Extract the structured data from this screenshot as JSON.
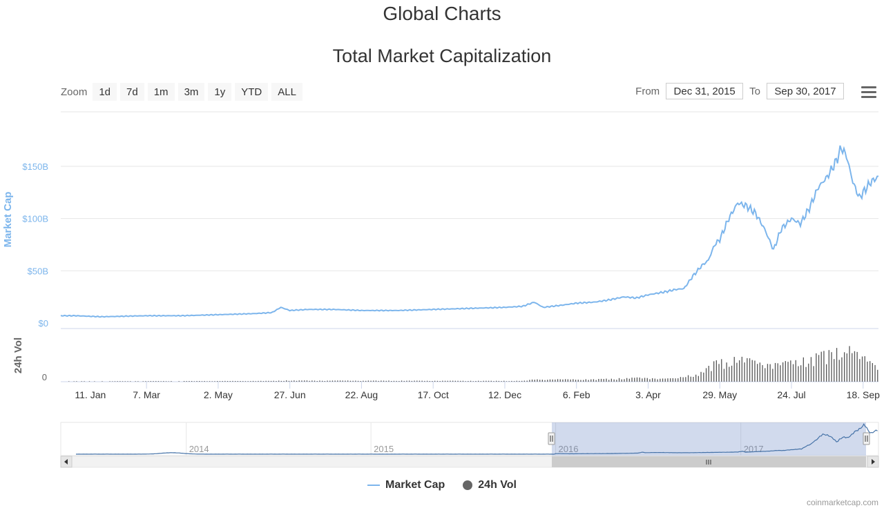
{
  "page": {
    "title": "Global Charts"
  },
  "toolbar": {
    "zoom_label": "Zoom",
    "zoom_buttons": [
      "1d",
      "7d",
      "1m",
      "3m",
      "1y",
      "YTD",
      "ALL"
    ],
    "from_label": "From",
    "from_value": "Dec 31, 2015",
    "to_label": "To",
    "to_value": "Sep 30, 2017",
    "menu_icon": "hamburger-menu-icon"
  },
  "legend": [
    {
      "label": "Market Cap",
      "color": "#7cb5ec",
      "icon": "line-icon"
    },
    {
      "label": "24h Vol",
      "color": "#666666",
      "icon": "circle-icon"
    }
  ],
  "credit": "coinmarketcap.com",
  "colors": {
    "market_cap": "#7cb5ec",
    "volume": "#555555",
    "navigator_line": "#4572a7",
    "navigator_mask": "rgba(102,133,194,0.3)"
  },
  "chart_data": {
    "type": "line",
    "title": "Total Market Capitalization",
    "x_tick_labels": [
      "11. Jan",
      "7. Mar",
      "2. May",
      "27. Jun",
      "22. Aug",
      "17. Oct",
      "12. Dec",
      "6. Feb",
      "3. Apr",
      "29. May",
      "24. Jul",
      "18. Sep"
    ],
    "market_cap": {
      "ylabel": "Market Cap",
      "y_tick_labels": [
        "$0",
        "$50B",
        "$100B",
        "$150B"
      ],
      "ylim": [
        0,
        200
      ],
      "unit": "billion USD",
      "series": [
        {
          "name": "Market Cap",
          "x": [
            "2015-12-31",
            "2016-01-11",
            "2016-02-01",
            "2016-03-07",
            "2016-04-04",
            "2016-05-02",
            "2016-05-30",
            "2016-06-13",
            "2016-06-20",
            "2016-06-27",
            "2016-07-11",
            "2016-08-01",
            "2016-08-22",
            "2016-09-19",
            "2016-10-17",
            "2016-11-14",
            "2016-12-12",
            "2016-12-26",
            "2017-01-04",
            "2017-01-11",
            "2017-01-25",
            "2017-02-06",
            "2017-02-20",
            "2017-03-03",
            "2017-03-15",
            "2017-03-25",
            "2017-04-03",
            "2017-04-17",
            "2017-04-24",
            "2017-05-01",
            "2017-05-08",
            "2017-05-15",
            "2017-05-20",
            "2017-05-25",
            "2017-05-29",
            "2017-06-05",
            "2017-06-12",
            "2017-06-19",
            "2017-06-26",
            "2017-07-03",
            "2017-07-10",
            "2017-07-16",
            "2017-07-24",
            "2017-07-31",
            "2017-08-07",
            "2017-08-14",
            "2017-08-21",
            "2017-08-28",
            "2017-09-01",
            "2017-09-05",
            "2017-09-10",
            "2017-09-15",
            "2017-09-18",
            "2017-09-24",
            "2017-09-30"
          ],
          "values": [
            7,
            7,
            6,
            7,
            7,
            8,
            9,
            10,
            15,
            12,
            13,
            13,
            12,
            12,
            13,
            14,
            15,
            16,
            20,
            15,
            17,
            19,
            20,
            22,
            25,
            24,
            27,
            30,
            32,
            33,
            45,
            55,
            60,
            75,
            80,
            100,
            115,
            112,
            105,
            90,
            70,
            90,
            100,
            95,
            110,
            130,
            140,
            155,
            168,
            160,
            135,
            120,
            125,
            135,
            140
          ]
        }
      ]
    },
    "volume": {
      "ylabel": "24h Vol",
      "y_tick_labels": [
        "0"
      ],
      "ylim": [
        0,
        6
      ],
      "unit": "billion USD",
      "series": [
        {
          "name": "24h Vol",
          "x": [
            "2015-12-31",
            "2016-06-13",
            "2016-06-20",
            "2016-12-26",
            "2017-01-04",
            "2017-02-20",
            "2017-03-25",
            "2017-04-24",
            "2017-05-15",
            "2017-05-25",
            "2017-06-12",
            "2017-06-26",
            "2017-07-16",
            "2017-07-31",
            "2017-08-14",
            "2017-08-28",
            "2017-09-05",
            "2017-09-15",
            "2017-09-30"
          ],
          "values": [
            0.05,
            0.1,
            0.15,
            0.1,
            0.3,
            0.3,
            0.5,
            0.4,
            1.2,
            2.5,
            3.0,
            2.6,
            2.3,
            2.8,
            3.4,
            4.0,
            4.5,
            3.2,
            2.3
          ]
        }
      ]
    },
    "navigator": {
      "year_labels": [
        "2014",
        "2015",
        "2016",
        "2017"
      ],
      "selected_range": [
        "2015-12-31",
        "2017-09-30"
      ]
    },
    "grid": true,
    "legend_position": "bottom-center"
  }
}
